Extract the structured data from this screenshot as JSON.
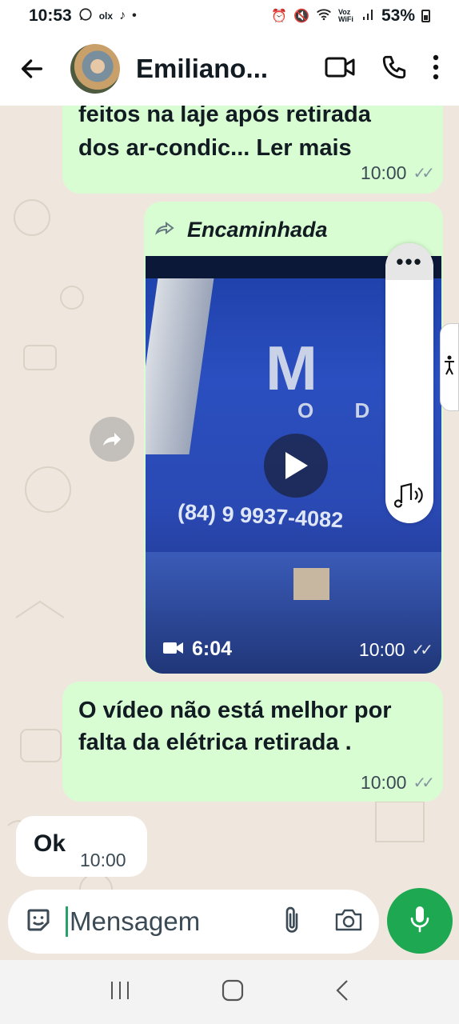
{
  "status_bar": {
    "time": "10:53",
    "olx": "olx",
    "battery": "53%",
    "voz_wifi": "Voz WiFi"
  },
  "header": {
    "contact_name": "Emiliano..."
  },
  "messages": [
    {
      "type": "outgoing-text",
      "text_cut": "feitos na laje  após retirada",
      "text": "dos ar-condic... Ler mais",
      "time": "10:00"
    },
    {
      "type": "outgoing-video",
      "forwarded_label": "Encaminhada",
      "sign_letters": "M",
      "sign_sub": "O D",
      "sign_phone": "(84) 9 9937-4082",
      "duration": "6:04",
      "time": "10:00"
    },
    {
      "type": "outgoing-text",
      "text": "O vídeo  não  está  melhor por falta da  elétrica retirada .",
      "time": "10:00"
    },
    {
      "type": "incoming-text",
      "text": "Ok",
      "time": "10:00"
    }
  ],
  "side_panel": {
    "more": "•••"
  },
  "composer": {
    "placeholder": "Mensagem"
  },
  "colors": {
    "outgoing_bubble": "#d9fdd3",
    "chat_background": "#efe7de",
    "accent_green": "#1da851"
  }
}
